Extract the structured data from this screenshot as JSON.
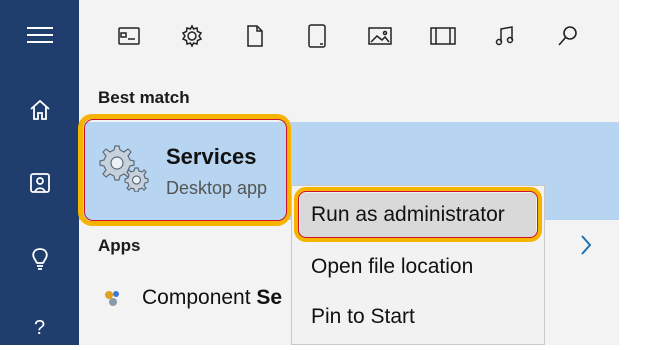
{
  "sidebar": {
    "items": [
      "menu-icon",
      "home-icon",
      "collections-icon",
      "lightbulb-icon",
      "help-icon"
    ],
    "help_label": "?"
  },
  "filters": [
    "app-window-icon",
    "gear-icon",
    "document-icon",
    "tablet-icon",
    "photo-icon",
    "video-icon",
    "music-icon",
    "search-icon"
  ],
  "best_match": {
    "heading": "Best match",
    "title": "Services",
    "subtitle": "Desktop app"
  },
  "apps": {
    "heading": "Apps",
    "item_prefix": "Component ",
    "item_bold": "Se"
  },
  "context_menu": {
    "items": [
      "Run as administrator",
      "Open file location",
      "Pin to Start"
    ]
  },
  "colors": {
    "sidebar": "#1f3e6e",
    "highlight": "#f4b400",
    "outline": "#d0132c",
    "selection": "#b7d5f0"
  }
}
